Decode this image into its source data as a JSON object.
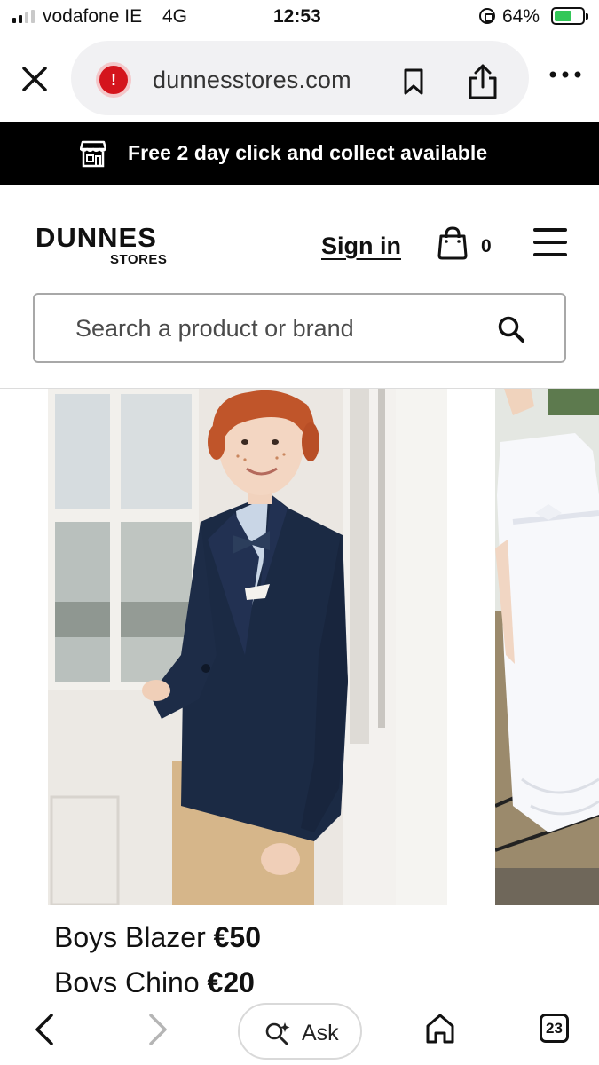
{
  "status_bar": {
    "carrier": "vodafone IE",
    "network": "4G",
    "time": "12:53",
    "battery_pct": "64%",
    "battery_level": 0.64,
    "icons": [
      "signal-icon",
      "orientation-lock-icon",
      "battery-charging-icon"
    ]
  },
  "browser": {
    "url": "dunnesstores.com",
    "warning_symbol": "!",
    "icons": [
      "close-icon",
      "warning-icon",
      "bookmark-icon",
      "share-icon",
      "more-icon"
    ]
  },
  "promo": {
    "text": "Free 2 day click and collect available",
    "icon": "store-icon"
  },
  "header": {
    "logo_main": "DUNNES",
    "logo_sub": "STORES",
    "sign_in": "Sign in",
    "bag_count": "0",
    "icons": [
      "bag-icon",
      "menu-icon"
    ]
  },
  "search": {
    "placeholder": "Search a product or brand",
    "icon": "search-icon"
  },
  "products": [
    {
      "name": "Boys Blazer",
      "price": "€50"
    },
    {
      "name": "Boys Chino",
      "price": "€20"
    }
  ],
  "bottom_bar": {
    "ask_label": "Ask",
    "tab_count": "23",
    "icons": [
      "back-icon",
      "forward-icon",
      "ask-sparkle-icon",
      "home-icon",
      "tabs-icon"
    ]
  },
  "colors": {
    "promo_bg": "#000000",
    "warning": "#d4141c",
    "battery_fill": "#34c759",
    "blazer": "#1b2a44",
    "chino": "#d8b98c"
  }
}
